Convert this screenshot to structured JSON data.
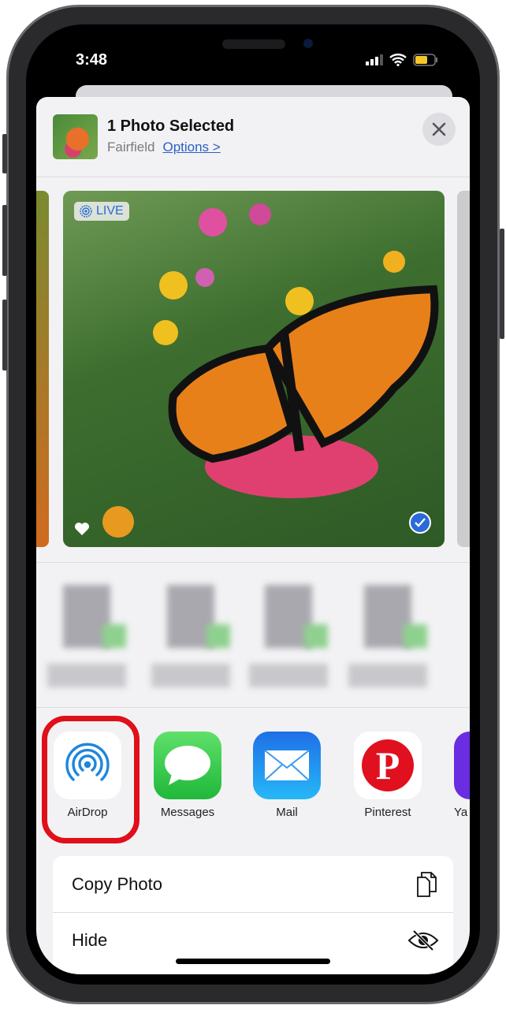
{
  "status_bar": {
    "time": "3:48"
  },
  "header": {
    "title": "1 Photo Selected",
    "location": "Fairfield",
    "options_label": "Options >"
  },
  "photo": {
    "badge": "LIVE",
    "selected": true
  },
  "apps": [
    {
      "label": "AirDrop",
      "icon": "airdrop-icon",
      "highlighted": true
    },
    {
      "label": "Messages",
      "icon": "messages-icon"
    },
    {
      "label": "Mail",
      "icon": "mail-icon"
    },
    {
      "label": "Pinterest",
      "icon": "pinterest-icon"
    },
    {
      "label": "Ya",
      "icon": "yahoo-icon"
    }
  ],
  "actions": [
    {
      "label": "Copy Photo",
      "icon": "copy-icon"
    },
    {
      "label": "Hide",
      "icon": "eye-slash-icon"
    }
  ],
  "colors": {
    "highlight": "#e0101a",
    "link": "#2b5fc4",
    "accent": "#2b6ad8"
  }
}
